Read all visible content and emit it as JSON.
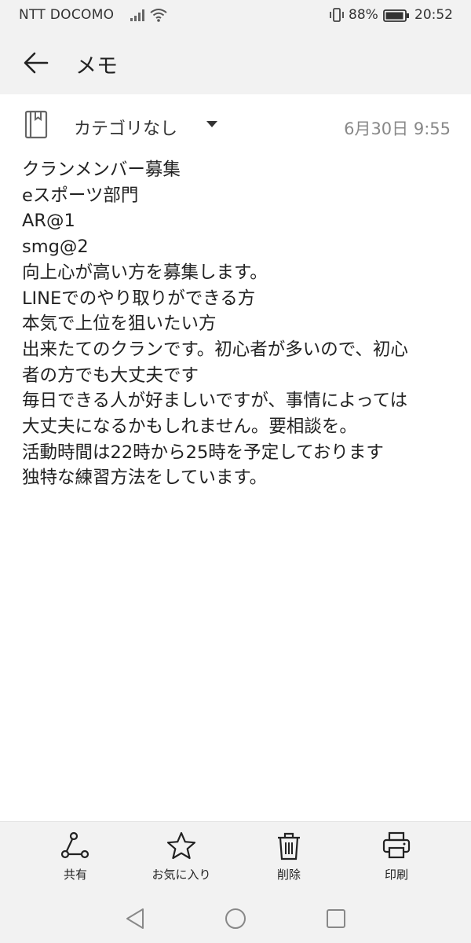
{
  "status_bar": {
    "carrier": "NTT DOCOMO",
    "battery_percent": "88%",
    "time": "20:52"
  },
  "app_bar": {
    "title": "メモ"
  },
  "note": {
    "category": "カテゴリなし",
    "date": "6月30日 9:55",
    "lines": [
      "クランメンバー募集",
      "eスポーツ部門",
      "AR@1",
      "smg@2",
      "向上心が高い方を募集します。",
      "LINEでのやり取りができる方",
      "本気で上位を狙いたい方",
      "出来たてのクランです。初心者が多いので、初心",
      "者の方でも大丈夫です",
      "毎日できる人が好ましいですが、事情によっては",
      "大丈夫になるかもしれません。要相談を。",
      "活動時間は22時から25時を予定しております",
      "独特な練習方法をしています。"
    ]
  },
  "toolbar": {
    "share_label": "共有",
    "favorite_label": "お気に入り",
    "delete_label": "削除",
    "print_label": "印刷"
  },
  "icons": {
    "back": "arrow-left-icon",
    "notebook": "notebook-icon",
    "share": "share-icon",
    "favorite": "star-icon",
    "delete": "trash-icon",
    "print": "printer-icon"
  },
  "colors": {
    "bar_bg": "#f2f2f2",
    "text": "#222222",
    "muted": "#888888"
  }
}
